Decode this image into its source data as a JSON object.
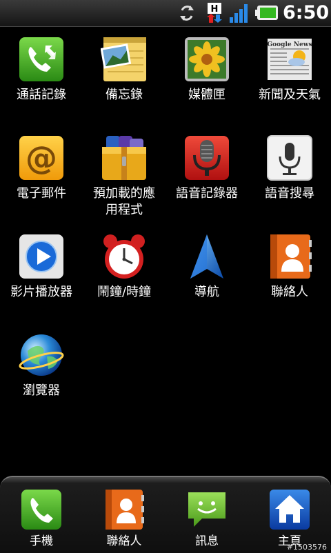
{
  "status_bar": {
    "time": "6:50",
    "network_badge": "H",
    "icons": [
      "sync-icon",
      "hsdpa-icon",
      "signal-icon",
      "battery-icon"
    ]
  },
  "apps": [
    {
      "label": "通話記錄",
      "icon": "call-log-icon"
    },
    {
      "label": "備忘錄",
      "icon": "notes-icon"
    },
    {
      "label": "媒體匣",
      "icon": "gallery-icon"
    },
    {
      "label": "新聞及天氣",
      "icon": "news-weather-icon",
      "badge_text": "Google News"
    },
    {
      "label": "電子郵件",
      "icon": "email-icon"
    },
    {
      "label": "預加載的應\n用程式",
      "icon": "preloaded-apps-icon"
    },
    {
      "label": "語音記錄器",
      "icon": "voice-recorder-icon"
    },
    {
      "label": "語音搜尋",
      "icon": "voice-search-icon"
    },
    {
      "label": "影片播放器",
      "icon": "video-player-icon"
    },
    {
      "label": "鬧鐘/時鐘",
      "icon": "alarm-clock-icon"
    },
    {
      "label": "導航",
      "icon": "navigation-icon"
    },
    {
      "label": "聯絡人",
      "icon": "contacts-icon"
    },
    {
      "label": "瀏覽器",
      "icon": "browser-icon"
    }
  ],
  "dock": [
    {
      "label": "手機",
      "icon": "phone-icon"
    },
    {
      "label": "聯絡人",
      "icon": "contacts-icon"
    },
    {
      "label": "訊息",
      "icon": "messaging-icon"
    },
    {
      "label": "主頁",
      "icon": "home-icon"
    }
  ],
  "watermark": "#1503576",
  "colors": {
    "background": "#000000",
    "call_green": "#3a9b1a",
    "orange": "#e8701a",
    "red": "#d42020",
    "blue": "#1a5fc8"
  }
}
